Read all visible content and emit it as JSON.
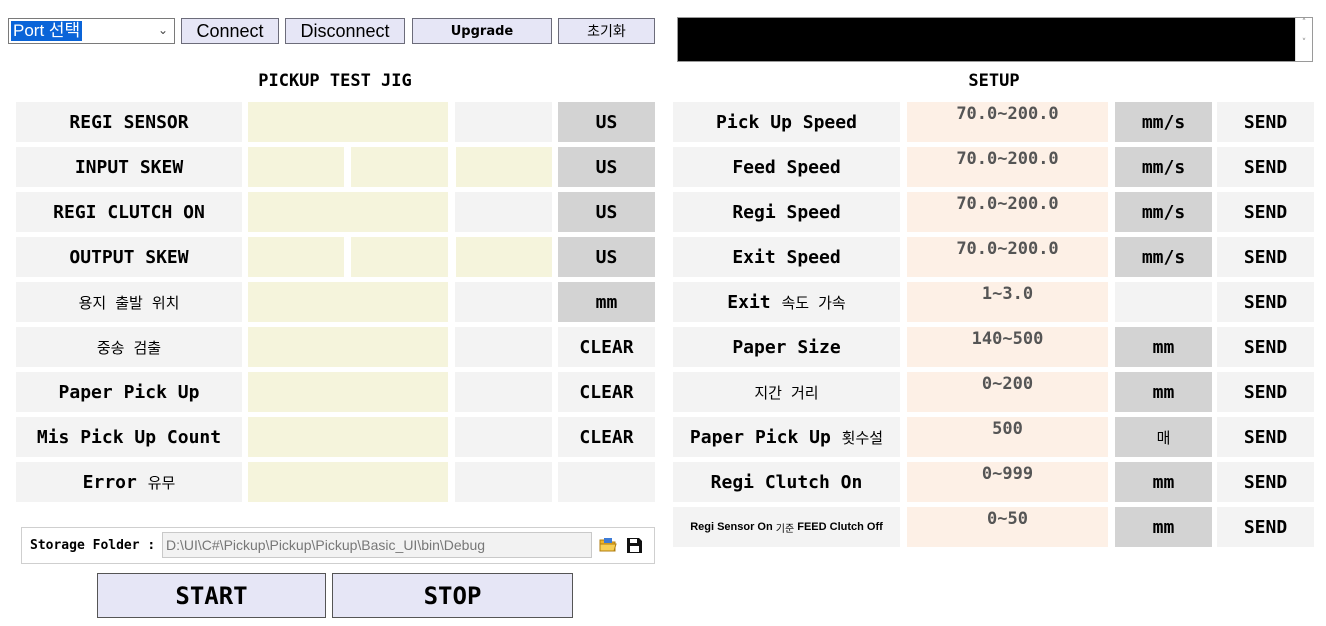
{
  "toolbar": {
    "port_select_value": "Port 선택",
    "connect_label": "Connect",
    "disconnect_label": "Disconnect",
    "upgrade_label": "Upgrade",
    "reset_label": "초기화"
  },
  "pickup": {
    "title": "PICKUP TEST JIG",
    "rows": [
      {
        "label": "REGI SENSOR",
        "unit": "US"
      },
      {
        "label": "INPUT SKEW",
        "unit": "US"
      },
      {
        "label": "REGI CLUTCH ON",
        "unit": "US"
      },
      {
        "label": "OUTPUT SKEW",
        "unit": "US"
      },
      {
        "label": "용지 출발 위치",
        "unit": "mm"
      },
      {
        "label": "중송 검출",
        "action": "CLEAR"
      },
      {
        "label": "Paper Pick Up",
        "action": "CLEAR"
      },
      {
        "label": "Mis Pick Up Count",
        "action": "CLEAR"
      },
      {
        "label_en": "Error",
        "label_ko": "유무"
      }
    ]
  },
  "setup": {
    "title": "SETUP",
    "send_label": "SEND",
    "rows": [
      {
        "label": "Pick Up Speed",
        "range": "70.0~200.0",
        "unit": "mm/s"
      },
      {
        "label": "Feed Speed",
        "range": "70.0~200.0",
        "unit": "mm/s"
      },
      {
        "label": "Regi Speed",
        "range": "70.0~200.0",
        "unit": "mm/s"
      },
      {
        "label": "Exit Speed",
        "range": "70.0~200.0",
        "unit": "mm/s"
      },
      {
        "label_en": "Exit",
        "label_ko": "속도 가속",
        "range": "1~3.0",
        "unit": ""
      },
      {
        "label": "Paper Size",
        "range": "140~500",
        "unit": "mm"
      },
      {
        "label": "지간 거리",
        "range": "0~200",
        "unit": "mm"
      },
      {
        "label_en": "Paper Pick Up",
        "label_ko": "횟수설",
        "range": "500",
        "unit": "매"
      },
      {
        "label": "Regi Clutch On",
        "range": "0~999",
        "unit": "mm"
      },
      {
        "label_a": "Regi Sensor On",
        "label_b": "기준",
        "label_c": "FEED Clutch Off",
        "range": "0~50",
        "unit": "mm"
      }
    ]
  },
  "storage": {
    "label": "Storage Folder :",
    "path": "D:\\UI\\C#\\Pickup\\Pickup\\Pickup\\Basic_UI\\bin\\Debug"
  },
  "actions": {
    "start_label": "START",
    "stop_label": "STOP"
  },
  "icons": {
    "folder": "folder-open-icon",
    "save": "floppy-disk-icon"
  },
  "colors": {
    "button_bg": "#e6e6f6",
    "value_bg": "#f5f4dc",
    "range_bg": "#fdf0e6",
    "unit_bg": "#d3d3d3",
    "label_bg": "#f3f3f3",
    "selection": "#0a64d8"
  }
}
